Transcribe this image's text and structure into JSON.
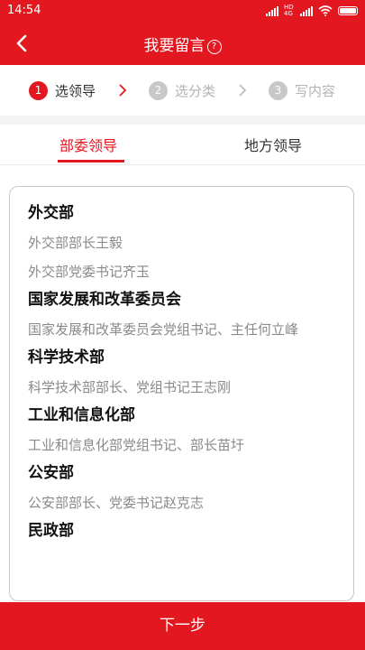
{
  "status_bar": {
    "time": "14:54",
    "network": "HD 4G"
  },
  "header": {
    "title": "我要留言",
    "help": "?"
  },
  "steps": [
    {
      "num": "1",
      "label": "选领导"
    },
    {
      "num": "2",
      "label": "选分类"
    },
    {
      "num": "3",
      "label": "写内容"
    }
  ],
  "tabs": [
    {
      "label": "部委领导"
    },
    {
      "label": "地方领导"
    }
  ],
  "list": [
    {
      "dept": "外交部",
      "leaders": [
        "外交部部长王毅",
        "外交部党委书记齐玉"
      ]
    },
    {
      "dept": "国家发展和改革委员会",
      "leaders": [
        "国家发展和改革委员会党组书记、主任何立峰"
      ]
    },
    {
      "dept": "科学技术部",
      "leaders": [
        "科学技术部部长、党组书记王志刚"
      ]
    },
    {
      "dept": "工业和信息化部",
      "leaders": [
        "工业和信息化部党组书记、部长苗圩"
      ]
    },
    {
      "dept": "公安部",
      "leaders": [
        "公安部部长、党委书记赵克志"
      ]
    },
    {
      "dept": "民政部",
      "leaders": []
    }
  ],
  "footer": {
    "next_label": "下一步"
  },
  "colors": {
    "brand": "#e3171f"
  }
}
